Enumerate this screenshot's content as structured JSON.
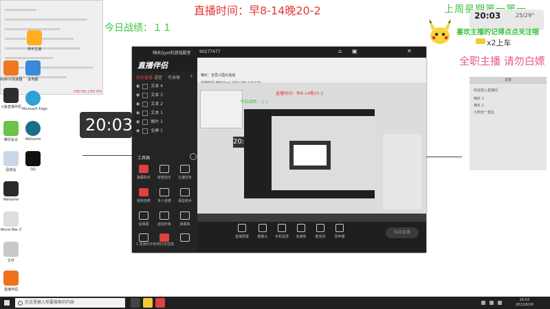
{
  "overlay": {
    "live_time": "直播时间：早8-14晚20-2",
    "today_score": "今日战绩：１１",
    "last_week": "上周星期第一第一",
    "follow_banner": "喜欢主播的记得点点关注哦",
    "gold_text": "x2上车",
    "fulltime": "全职主播 请勿白嫖"
  },
  "clock": {
    "big": "20:03",
    "widget_time": "20:03",
    "widget_weather": "25/29°"
  },
  "monitor": {
    "cpu": "CPU 0%  CPU 0%"
  },
  "desktop_icons": [
    {
      "label": "快手主播"
    },
    {
      "label": "网易UU加速器"
    },
    {
      "label": "斗鱼直播伴侣"
    },
    {
      "label": "此电脑"
    },
    {
      "label": "Microsoft Edge"
    },
    {
      "label": "腾讯会议"
    },
    {
      "label": "WeGame"
    },
    {
      "label": "回收站"
    },
    {
      "label": "QQ"
    },
    {
      "label": "WeGame"
    },
    {
      "label": "World War Z"
    },
    {
      "label": "文件"
    },
    {
      "label": "直播伴侣"
    }
  ],
  "chat": {
    "header": "文件",
    "lines": [
      "欢迎进入直播间",
      "嗨天 1",
      "嗨天 2",
      "小粉丝一直在"
    ]
  },
  "app": {
    "titlebar_title": "嗨天Qyxl的游戏殿堂",
    "titlebar_id": "90277477",
    "logo": "直播伴侣",
    "tabs": [
      "我的直播",
      "语音",
      "可录像"
    ],
    "layers": [
      "文本 4",
      "文本 3",
      "文本 2",
      "文本 1",
      "图片 1",
      "全屏 1"
    ],
    "tools_title": "工具箱",
    "tools": [
      "弹幕助手",
      "房管助手",
      "主播任务",
      "抢购连麦",
      "多人连麦",
      "语音助手",
      "投弹幕",
      "虚拟形象",
      "弹幕库",
      "",
      "",
      ""
    ],
    "sidebar_footer": "1.直播间中使用抖音直播",
    "room_title": "嗨天：全员三国大混战",
    "room_meta": "开播时间  嗨天Qyxl  2001790  120225",
    "bottom": [
      "直播屏幕",
      "摄像头",
      "手机投屏",
      "多媒体",
      "麦克风",
      "扬声器"
    ],
    "go_live": "结束直播"
  },
  "taskbar": {
    "search_placeholder": "在这里输入你要搜索的内容",
    "time": "20:03",
    "date": "2022/6/18"
  }
}
